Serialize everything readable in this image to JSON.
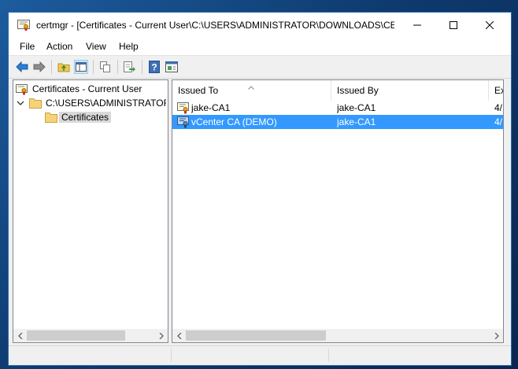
{
  "window": {
    "title": "certmgr - [Certificates - Current User\\C:\\USERS\\ADMINISTRATOR\\DOWNLOADS\\CE..."
  },
  "menu": [
    "File",
    "Action",
    "View",
    "Help"
  ],
  "toolbar": {
    "icons": [
      "back-arrow-icon",
      "forward-arrow-icon",
      "up-folder-icon",
      "show-hide-tree-icon",
      "copy-icon",
      "export-list-icon",
      "help-icon",
      "properties-icon"
    ]
  },
  "tree": {
    "root": "Certificates - Current User",
    "store": "C:\\USERS\\ADMINISTRATOR\\DOWNLOADS\\C",
    "folder": "Certificates"
  },
  "list": {
    "columns": [
      "Issued To",
      "Issued By",
      "Ex"
    ],
    "rows": [
      {
        "issued_to": "jake-CA1",
        "issued_by": "jake-CA1",
        "exp": "4/"
      },
      {
        "issued_to": "vCenter CA (DEMO)",
        "issued_by": "jake-CA1",
        "exp": "4/"
      }
    ]
  },
  "colors": {
    "selection": "#3399ff",
    "accent": "#2b6cb0"
  }
}
